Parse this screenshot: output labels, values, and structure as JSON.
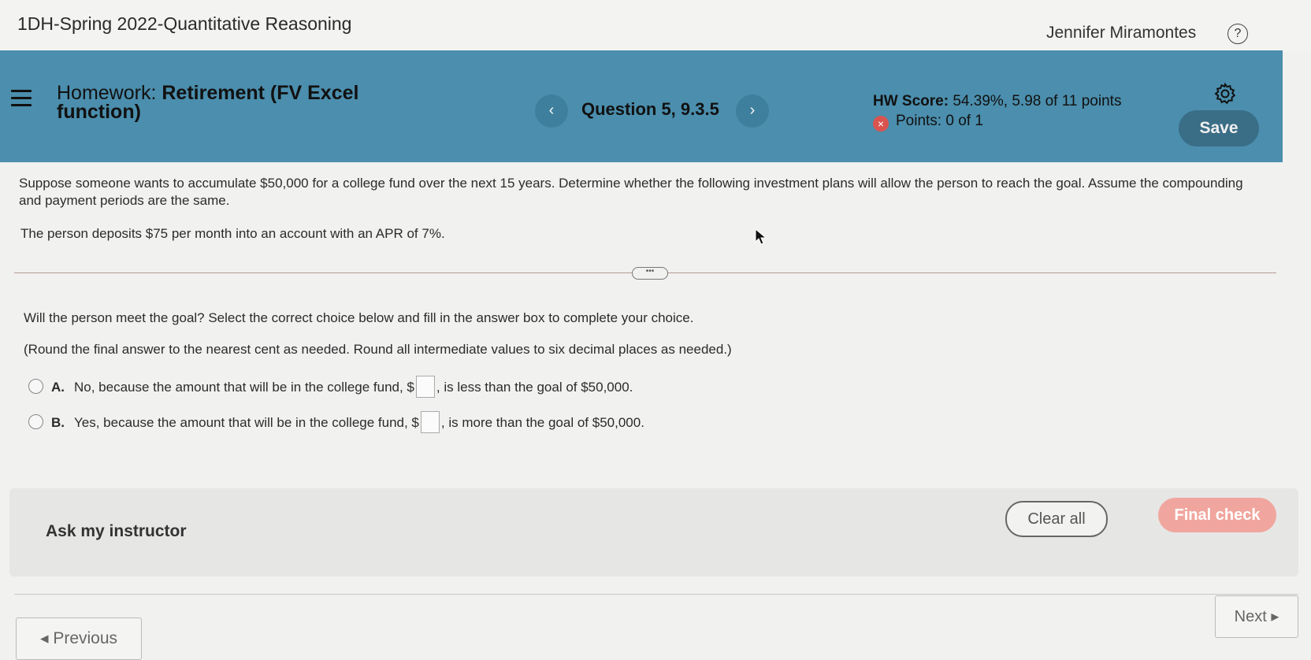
{
  "header": {
    "course_title": "1DH-Spring 2022-Quantitative Reasoning",
    "user_name": "Jennifer Miramontes",
    "help_glyph": "?"
  },
  "homework_bar": {
    "title_prefix": "Homework:",
    "title_main": "Retirement (FV Excel function)",
    "question_label": "Question 5, 9.3.5",
    "prev_glyph": "‹",
    "next_glyph": "›",
    "score_label": "HW Score:",
    "score_value": "54.39%, 5.98 of 11 points",
    "points": "Points: 0 of 1",
    "points_icon": "×",
    "save_label": "Save"
  },
  "problem": {
    "statement": "Suppose someone wants to accumulate $50,000 for a college fund over the next 15 years. Determine whether the following investment plans will allow the person to reach the goal. Assume the compounding and payment periods are the same.",
    "deposit": "The person deposits $75 per month into an account with an APR of 7%."
  },
  "question": {
    "prompt": "Will the person meet the goal? Select the correct choice below and fill in the answer box to complete your choice.",
    "round_note": "(Round the final answer to the nearest cent as needed. Round all intermediate values to six decimal places as needed.)",
    "choices": [
      {
        "letter": "A.",
        "before": "No, because the amount that will be in the college fund, $",
        "after": ", is less than the goal of $50,000."
      },
      {
        "letter": "B.",
        "before": "Yes, because the amount that will be in the college fund, $",
        "after": ", is more than the goal of $50,000."
      }
    ]
  },
  "footer": {
    "ask_instructor": "Ask my instructor",
    "clear_all": "Clear all",
    "final_check": "Final check",
    "next": "Next ▸",
    "previous": "◂ Previous"
  },
  "colors": {
    "accent_bar": "#4b8ead",
    "save_button": "#3a6d86",
    "final_check": "#f0a69e",
    "error_icon": "#d9534f"
  },
  "icons": [
    "menu-icon",
    "help-icon",
    "gear-icon",
    "error-x-icon",
    "chevron-left-icon",
    "chevron-right-icon",
    "expand-dots-icon",
    "mouse-cursor-icon"
  ]
}
